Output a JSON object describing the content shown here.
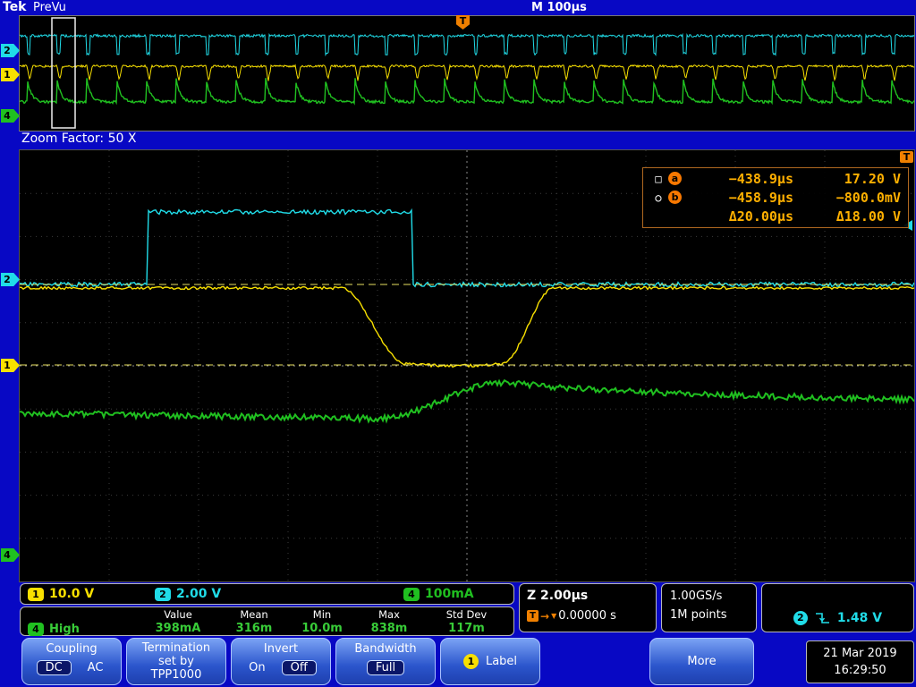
{
  "header": {
    "brand": "Tek",
    "status": "PreVu",
    "timebase": "M 100µs",
    "trigger_symbol": "T"
  },
  "zoom": {
    "factor_label": "Zoom Factor: 50 X"
  },
  "cursors": {
    "a": {
      "glyph": "□",
      "marker": "a",
      "time": "−438.9µs",
      "value": "17.20 V"
    },
    "b": {
      "glyph": "○",
      "marker": "b",
      "time": "−458.9µs",
      "value": "−800.0mV"
    },
    "delta": {
      "time": "Δ20.00µs",
      "value": "Δ18.00 V"
    }
  },
  "channels": {
    "ch1": {
      "num": "1",
      "scale": "10.0 V",
      "color": "#f8e000"
    },
    "ch2": {
      "num": "2",
      "scale": "2.00 V",
      "color": "#20dce8"
    },
    "ch4": {
      "num": "4",
      "scale": "100mA",
      "color": "#20c020"
    }
  },
  "horizontal": {
    "zoom_scale": "Z 2.00µs",
    "trig_symbol": "T",
    "delay_arrow": "→",
    "delay_marker": "▼",
    "delay": "0.00000 s",
    "sample_rate": "1.00GS/s",
    "record_length": "1M points"
  },
  "trigger": {
    "source_ch": "2",
    "level": "1.48 V"
  },
  "measurements": {
    "headers": [
      "Value",
      "Mean",
      "Min",
      "Max",
      "Std Dev"
    ],
    "rows": [
      {
        "ch": "4",
        "name": "High",
        "value": "398mA",
        "mean": "316m",
        "min": "10.0m",
        "max": "838m",
        "stddev": "117m"
      }
    ]
  },
  "datetime": {
    "date": "21 Mar 2019",
    "time": "16:29:50"
  },
  "menu": {
    "coupling": {
      "title": "Coupling",
      "dc": "DC",
      "ac": "AC",
      "selected": "DC"
    },
    "termination": {
      "line1": "Termination",
      "line2": "set by",
      "line3": "TPP1000"
    },
    "invert": {
      "title": "Invert",
      "on": "On",
      "off": "Off",
      "selected": "Off"
    },
    "bandwidth": {
      "title": "Bandwidth",
      "value": "Full"
    },
    "label": {
      "ch": "1",
      "text": "Label"
    },
    "more": {
      "text": "More"
    }
  },
  "waveforms": {
    "zoom_factor": 50,
    "ch2_pulse": "positive pulse ~3.4V high near left of zoom window",
    "ch1_dip": "drops from 17.2V baseline to about −0.8V in U-shape at center",
    "ch4_current": "noisy ~320mA line rising to ~400mA hump right of center"
  }
}
